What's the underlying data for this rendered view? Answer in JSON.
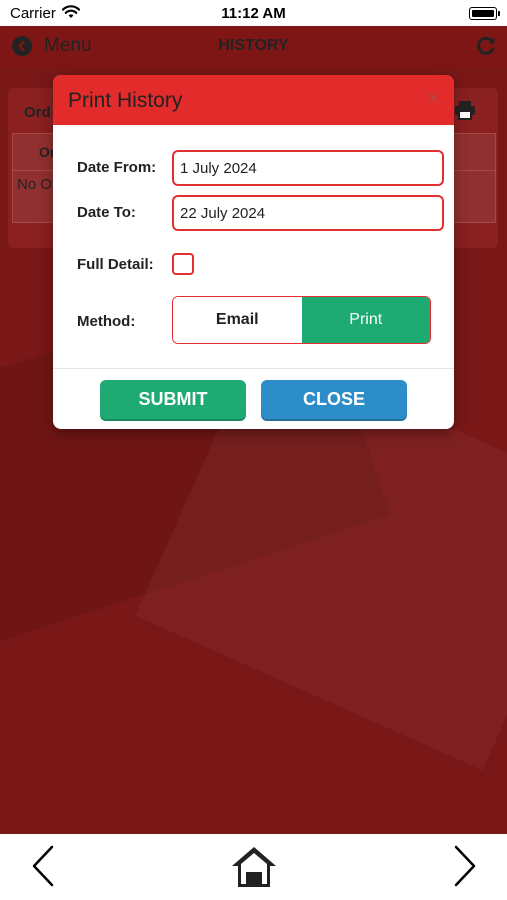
{
  "status": {
    "carrier": "Carrier",
    "time": "11:12 AM"
  },
  "nav": {
    "menu_label": "Menu",
    "title": "HISTORY"
  },
  "background_card": {
    "title_partial": "Ord",
    "col_header_partial": "Or",
    "empty_partial": "No O"
  },
  "dialog": {
    "title": "Print History",
    "close_glyph": "×",
    "date_from_label": "Date From:",
    "date_from_value": "1 July 2024",
    "date_to_label": "Date To:",
    "date_to_value": "22 July 2024",
    "full_detail_label": "Full Detail:",
    "full_detail_checked": false,
    "method_label": "Method:",
    "method_options": [
      "Email",
      "Print"
    ],
    "method_selected": "Print",
    "submit_label": "SUBMIT",
    "close_label": "CLOSE"
  },
  "icons": {
    "back": "back-circle-icon",
    "refresh": "refresh-icon",
    "printer": "printer-icon",
    "prev": "chevron-left-icon",
    "home": "home-icon",
    "next": "chevron-right-icon"
  },
  "colors": {
    "app_background": "#7a1717",
    "dialog_header": "#e32b2b",
    "field_border": "#e23030",
    "submit_green": "#1faa74",
    "close_blue": "#2d8dc8"
  }
}
